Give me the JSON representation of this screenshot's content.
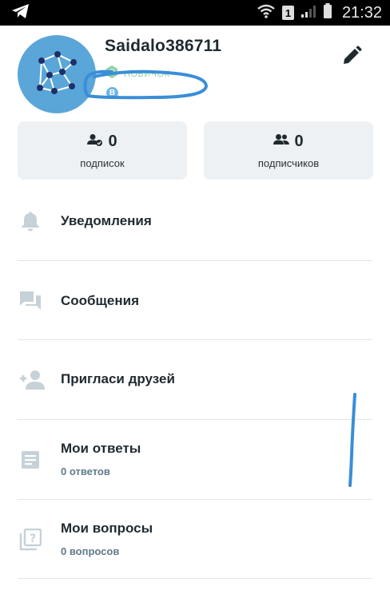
{
  "status_bar": {
    "time": "21:32",
    "sim_slot": "1",
    "icons": [
      "telegram-icon",
      "wifi-icon",
      "sim-icon",
      "signal-icon",
      "battery-icon"
    ]
  },
  "profile": {
    "username": "Saidalo386711",
    "rank": "НОВИЧОК",
    "coin_symbol": "B",
    "edit_icon": "pencil-icon",
    "avatar_color": "#5aa6d8"
  },
  "stats": {
    "following": {
      "count": "0",
      "label": "подписок",
      "icon": "user-check-icon"
    },
    "followers": {
      "count": "0",
      "label": "подписчиков",
      "icon": "users-icon"
    }
  },
  "menu": {
    "notifications": {
      "label": "Уведомления",
      "icon": "bell-icon"
    },
    "messages": {
      "label": "Сообщения",
      "icon": "chat-icon"
    },
    "invite": {
      "label": "Пригласи друзей",
      "icon": "add-user-icon"
    },
    "answers": {
      "label": "Мои ответы",
      "sub": "0 ответов",
      "icon": "document-icon"
    },
    "questions": {
      "label": "Мои вопросы",
      "sub": "0 вопросов",
      "icon": "question-icon"
    }
  },
  "colors": {
    "accent_blue": "#5aa6d8",
    "rank_green": "#8fd2a6",
    "card_bg": "#eef1f3",
    "annotation_pen": "#3a8ed8",
    "icon_gray": "#c6d2d8"
  }
}
